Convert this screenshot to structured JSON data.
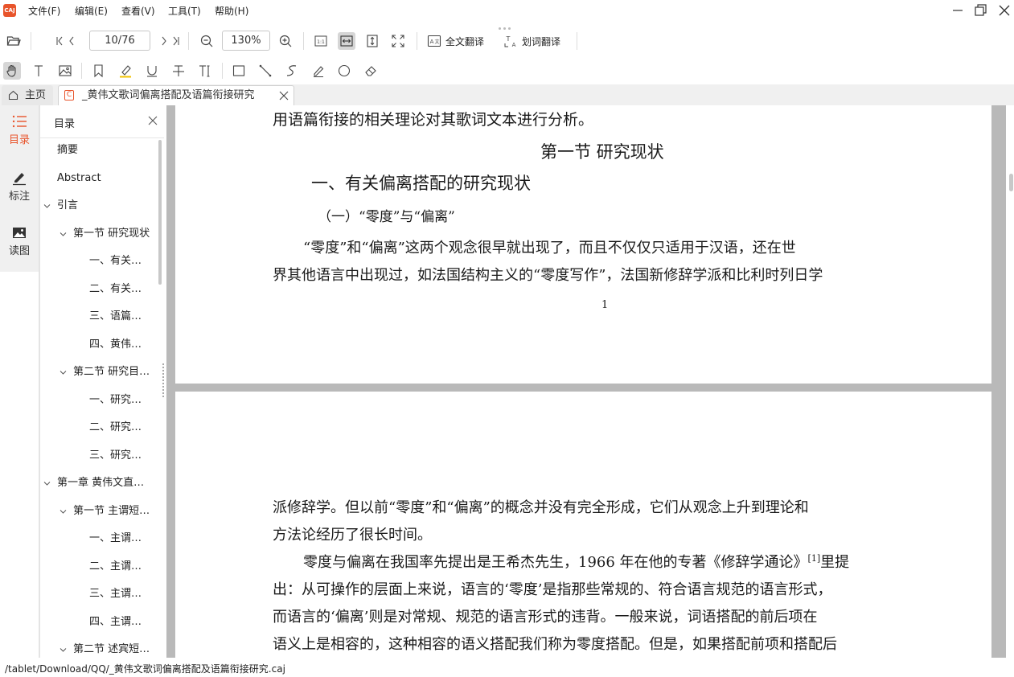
{
  "app": {
    "logo_text": "CAJ"
  },
  "menu": {
    "items": [
      "文件(F)",
      "编辑(E)",
      "查看(V)",
      "工具(T)",
      "帮助(H)"
    ]
  },
  "toolbar": {
    "page_value": "10/76",
    "zoom_value": "130%",
    "full_translate": "全文翻译",
    "word_translate": "划词翻译"
  },
  "tabs": {
    "home": "主页",
    "doc_icon_letter": "C",
    "doc_title": "_黄伟文歌词偏离搭配及语篇衔接研究"
  },
  "rail": {
    "toc": "目录",
    "notes": "标注",
    "figures": "读图",
    "accent_color": "#e8542b"
  },
  "toc": {
    "title": "目录",
    "items": [
      {
        "label": "摘要",
        "level": 0,
        "chevron": false
      },
      {
        "label": "Abstract",
        "level": 0,
        "chevron": false
      },
      {
        "label": "引言",
        "level": 0,
        "chevron": true
      },
      {
        "label": "第一节 研究现状",
        "level": 1,
        "chevron": true
      },
      {
        "label": "一、有关…",
        "level": 2,
        "chevron": false
      },
      {
        "label": "二、有关…",
        "level": 2,
        "chevron": false
      },
      {
        "label": "三、语篇…",
        "level": 2,
        "chevron": false
      },
      {
        "label": "四、黄伟…",
        "level": 2,
        "chevron": false
      },
      {
        "label": "第二节 研究目…",
        "level": 1,
        "chevron": true
      },
      {
        "label": "一、研究…",
        "level": 2,
        "chevron": false
      },
      {
        "label": "二、研究…",
        "level": 2,
        "chevron": false
      },
      {
        "label": "三、研究…",
        "level": 2,
        "chevron": false
      },
      {
        "label": "第一章 黄伟文直…",
        "level": 0,
        "chevron": true
      },
      {
        "label": "第一节 主谓短…",
        "level": 1,
        "chevron": true
      },
      {
        "label": "一、主谓…",
        "level": 2,
        "chevron": false
      },
      {
        "label": "二、主谓…",
        "level": 2,
        "chevron": false
      },
      {
        "label": "三、主谓…",
        "level": 2,
        "chevron": false
      },
      {
        "label": "四、主谓…",
        "level": 2,
        "chevron": false
      },
      {
        "label": "第二节 述宾短…",
        "level": 1,
        "chevron": true
      }
    ]
  },
  "document": {
    "page1": {
      "line_top": "用语篇衔接的相关理论对其歌词文本进行分析。",
      "section_heading": "第一节  研究现状",
      "subheading": "一、有关偏离搭配的研究现状",
      "sub_subheading": "（一）“零度”与“偏离”",
      "para_line1": "“零度”和“偏离”这两个观念很早就出现了，而且不仅仅只适用于汉语，还在世",
      "para_line2": "界其他语言中出现过，如法国结构主义的“零度写作”，法国新修辞学派和比利时列日学",
      "page_number": "1"
    },
    "page2": {
      "line1": "派修辞学。但以前“零度”和“偏离”的概念并没有完全形成，它们从观念上升到理论和",
      "line2": "方法论经历了很长时间。",
      "line3": "零度与偏离在我国率先提出是王希杰先生，1966 年在他的专著《修辞学通论》",
      "line3_ref": "[1]",
      "line3_end": "里提",
      "line4": "出：从可操作的层面上来说，语言的‘零度’是指那些常规的、符合语言规范的语言形式，",
      "line5": "而语言的‘偏离’则是对常规、规范的语言形式的违背。一般来说，词语搭配的前后项在",
      "line6": "语义上是相容的，这种相容的语义搭配我们称为零度搭配。但是，如果搭配前项和搭配后"
    }
  },
  "status": {
    "path": "/tablet/Download/QQ/_黄伟文歌词偏离搭配及语篇衔接研究.caj"
  }
}
